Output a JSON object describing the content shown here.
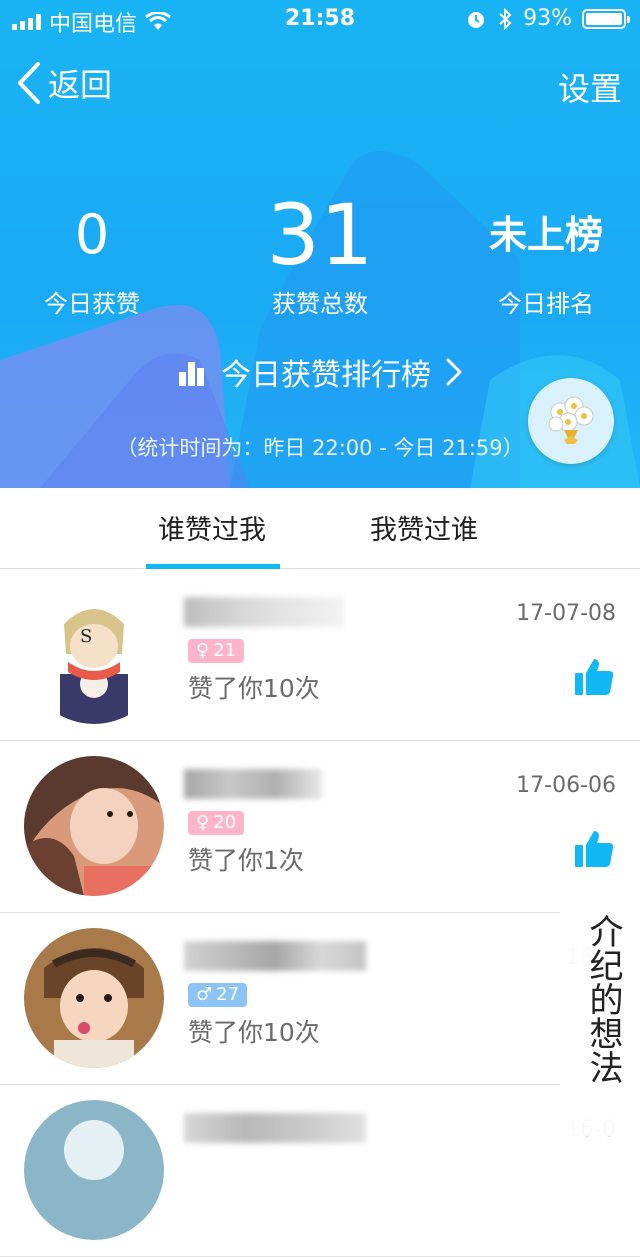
{
  "status_bar": {
    "carrier": "中国电信",
    "time": "21:58",
    "battery": "93%"
  },
  "nav": {
    "back_label": "返回",
    "settings_label": "设置"
  },
  "stats": {
    "today_likes_value": "0",
    "today_likes_label": "今日获赞",
    "total_likes_value": "31",
    "total_likes_label": "获赞总数",
    "today_rank_value": "未上榜",
    "today_rank_label": "今日排名"
  },
  "rank_link": {
    "label": "今日获赞排行榜",
    "stats_time": "（统计时间为：昨日 22:00 - 今日 21:59）"
  },
  "tabs": [
    {
      "label": "谁赞过我",
      "active": true
    },
    {
      "label": "我赞过谁",
      "active": false
    }
  ],
  "likes": [
    {
      "gender": "female",
      "age": "21",
      "liked_text": "赞了你10次",
      "date": "17-07-08"
    },
    {
      "gender": "female",
      "age": "20",
      "liked_text": "赞了你1次",
      "date": "17-06-06"
    },
    {
      "gender": "male",
      "age": "27",
      "liked_text": "赞了你10次",
      "date": "16-0"
    },
    {
      "gender": "",
      "age": "",
      "liked_text": "",
      "date": "16-0"
    }
  ],
  "watermark": {
    "text": "介纪的想法"
  },
  "colors": {
    "header_blue": "#19b4f4",
    "accent_blue": "#12b7f5",
    "female_badge": "#ffb4c8",
    "male_badge": "#8cc4f5"
  }
}
